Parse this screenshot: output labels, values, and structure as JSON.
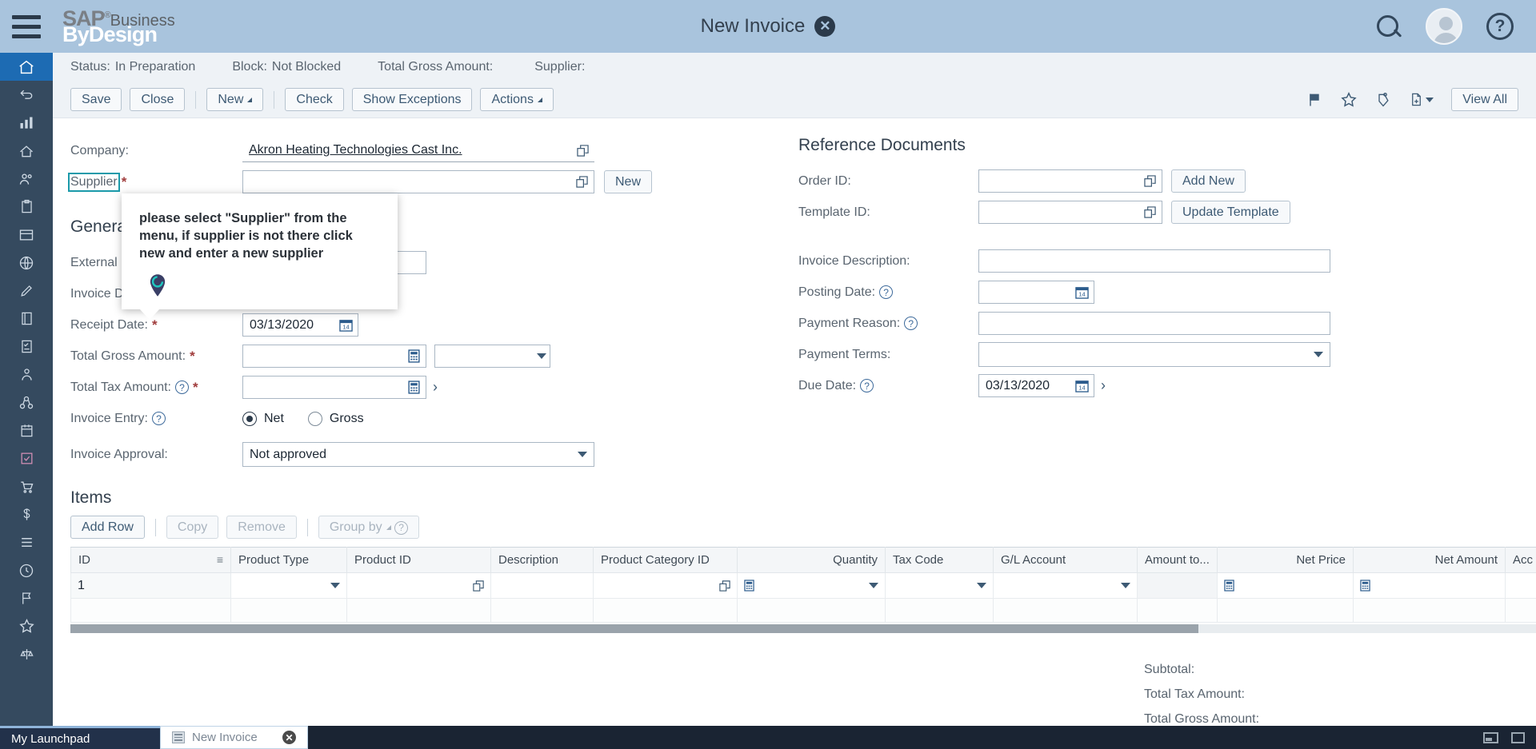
{
  "app": {
    "brand_line1": "SAP",
    "brand_sup": "®",
    "brand_business": "Business",
    "brand_line2": "ByDesign",
    "window_title": "New Invoice"
  },
  "statusbar": {
    "status_label": "Status:",
    "status_value": "In Preparation",
    "block_label": "Block:",
    "block_value": "Not Blocked",
    "total_gross_label": "Total Gross Amount:",
    "total_gross_value": "",
    "supplier_label": "Supplier:",
    "supplier_value": ""
  },
  "toolbar": {
    "save_label": "Save",
    "close_label": "Close",
    "new_label": "New",
    "check_label": "Check",
    "show_exceptions_label": "Show Exceptions",
    "actions_label": "Actions",
    "view_all_label": "View All"
  },
  "tooltip": {
    "text": "please select \"Supplier\" from the menu, if supplier is not there click new and enter a new supplier"
  },
  "header_fields": {
    "company_label": "Company:",
    "company_value": "Akron Heating Technologies Cast Inc.",
    "supplier_label": "Supplier",
    "supplier_value": "",
    "supplier_new_label": "New"
  },
  "general_information": {
    "section_title": "General Information",
    "external_document_id_label": "External Document ID:",
    "external_document_id_value": "",
    "invoice_date_label": "Invoice Date:",
    "invoice_date_value": "",
    "receipt_date_label": "Receipt Date:",
    "receipt_date_value": "03/13/2020",
    "total_gross_amount_label": "Total Gross Amount:",
    "total_gross_amount_value": "",
    "total_gross_currency": "",
    "total_tax_amount_label": "Total Tax Amount:",
    "total_tax_amount_value": "",
    "invoice_entry_label": "Invoice Entry:",
    "invoice_entry_net": "Net",
    "invoice_entry_gross": "Gross",
    "invoice_entry_selected": "Net",
    "invoice_approval_label": "Invoice Approval:",
    "invoice_approval_value": "Not approved"
  },
  "reference_documents": {
    "section_title": "Reference Documents",
    "order_id_label": "Order ID:",
    "order_id_value": "",
    "add_new_label": "Add New",
    "template_id_label": "Template ID:",
    "template_id_value": "",
    "update_template_label": "Update Template",
    "invoice_description_label": "Invoice Description:",
    "invoice_description_value": "",
    "posting_date_label": "Posting Date:",
    "posting_date_value": "",
    "payment_reason_label": "Payment Reason:",
    "payment_reason_value": "",
    "payment_terms_label": "Payment Terms:",
    "payment_terms_value": "",
    "due_date_label": "Due Date:",
    "due_date_value": "03/13/2020"
  },
  "items": {
    "section_title": "Items",
    "add_row_label": "Add Row",
    "copy_label": "Copy",
    "remove_label": "Remove",
    "group_by_label": "Group by",
    "columns": [
      "ID",
      "Product Type",
      "Product ID",
      "Description",
      "Product Category ID",
      "Quantity",
      "Tax Code",
      "G/L Account",
      "Amount to...",
      "Net Price",
      "Net Amount",
      "Acc"
    ],
    "rows": [
      {
        "id": "1",
        "product_type": "",
        "product_id": "",
        "description": "",
        "product_category_id": "",
        "quantity": "",
        "tax_code": "",
        "gl_account": "",
        "amount_to": "",
        "net_price": "",
        "net_amount": "",
        "acc": ""
      }
    ]
  },
  "totals": {
    "subtotal_label": "Subtotal:",
    "subtotal_value": "",
    "total_tax_label": "Total Tax Amount:",
    "total_tax_value": "",
    "total_gross_label": "Total Gross Amount:",
    "total_gross_value": ""
  },
  "taskbar": {
    "launchpad_label": "My Launchpad",
    "tab_label": "New Invoice"
  },
  "colors": {
    "topbar": "#a9c4dd",
    "rail": "#354a5f",
    "rail_active": "#1d6bb3",
    "accent": "#3d5a74",
    "highlight": "#1b9aaa",
    "required": "#a03c3c",
    "taskbar": "#1a2433"
  }
}
